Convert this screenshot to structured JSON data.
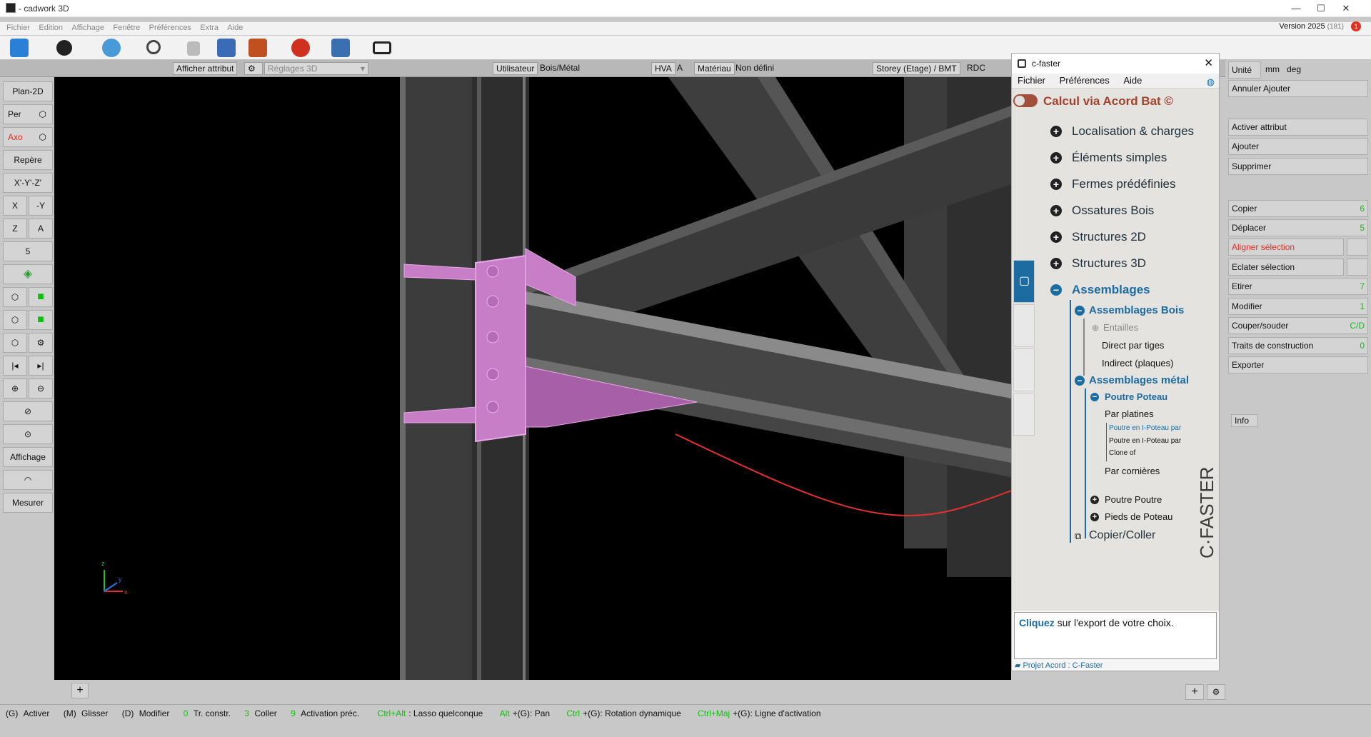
{
  "window": {
    "title": "- cadwork 3D",
    "version": "Version 2025",
    "version_build": "(181)",
    "notification_count": "1"
  },
  "menu": [
    "Fichier",
    "Edition",
    "Affichage",
    "Fenêtre",
    "Préférences",
    "Extra",
    "Aide"
  ],
  "toolbar_icons": [
    "cadwork-logo-icon",
    "record-icon",
    "cloud-c-icon",
    "search-icon",
    "lock-icon",
    "csv-export-icon",
    "dance-icon",
    "pdf-icon",
    "python-icon",
    "present-icon"
  ],
  "control_bar": {
    "attr_button": "Afficher attribut",
    "settings3d": "Réglages 3D",
    "user_label": "Utilisateur",
    "user_value": "Bois/Métal",
    "hva_label": "HVA",
    "hva_value": "A",
    "material_label": "Matériau",
    "material_value": "Non défini",
    "storey_label": "Storey (Etage) / BMT",
    "storey_value": "RDC"
  },
  "left_toolbar": {
    "plan2d": "Plan-2D",
    "per": "Per",
    "axo": "Axo",
    "repere": "Repère",
    "xyz": "X'-Y'-Z'",
    "x": "X",
    "neg_y": "-Y",
    "z": "Z",
    "a": "A",
    "five": "5",
    "affichage": "Affichage",
    "mesurer": "Mesurer"
  },
  "axes": {
    "x": "x",
    "y": "y",
    "z": "z"
  },
  "status_bar": [
    {
      "key": "(G)",
      "text": "Activer"
    },
    {
      "key": "(M)",
      "text": "Glisser"
    },
    {
      "key": "(D)",
      "text": "Modifier"
    },
    {
      "key": "0",
      "text": "Tr. constr."
    },
    {
      "key": "3",
      "text": "Coller"
    },
    {
      "key": "9",
      "text": "Activation préc."
    },
    {
      "key": "Ctrl+Alt",
      "text": ": Lasso quelconque"
    },
    {
      "key": "Alt",
      "text": "+(G): Pan"
    },
    {
      "key": "Ctrl",
      "text": "+(G): Rotation dynamique"
    },
    {
      "key": "Ctrl+Maj",
      "text": "+(G): Ligne d'activation"
    }
  ],
  "cfaster": {
    "title": "c-faster",
    "menu": [
      "Fichier",
      "Préférences",
      "Aide"
    ],
    "acord": "Calcul via Acord Bat ©",
    "categories": [
      "Localisation & charges",
      "Éléments simples",
      "Fermes prédéfinies",
      "Ossatures Bois",
      "Structures 2D",
      "Structures 3D",
      "Assemblages"
    ],
    "assemblages_bois": "Assemblages Bois",
    "entailles": "Entailles",
    "direct": "Direct par tiges",
    "indirect": "Indirect (plaques)",
    "assemblages_metal": "Assemblages métal",
    "poutre_poteau": "Poutre Poteau",
    "par_platines": "Par platines",
    "item1": "Poutre en I-Poteau par",
    "item2": "Poutre en I-Poteau par",
    "item3": "Clone of",
    "par_cornieres": "Par cornières",
    "poutre_poutre": "Poutre Poutre",
    "pieds": "Pieds de Poteau",
    "copier": "Copier/Coller",
    "brand": "C·FASTER",
    "info_click": "Cliquez",
    "info_rest": " sur l'export de votre choix.",
    "footer": "Projet Acord : C-Faster"
  },
  "right_panel": {
    "units": {
      "label": "Unité",
      "length": "mm",
      "angle": "deg"
    },
    "annuler": "Annuler Ajouter",
    "activer_attr": "Activer attribut",
    "ajouter": "Ajouter",
    "supprimer": "Supprimer",
    "actions": [
      {
        "label": "Copier",
        "key": "6"
      },
      {
        "label": "Déplacer",
        "key": "5"
      },
      {
        "label": "Aligner sélection",
        "key": ""
      },
      {
        "label": "Eclater sélection",
        "key": ""
      },
      {
        "label": "Etirer",
        "key": "7"
      },
      {
        "label": "Modifier",
        "key": "1"
      },
      {
        "label": "Couper/souder",
        "key": "C/D"
      },
      {
        "label": "Traits de construction",
        "key": "0"
      },
      {
        "label": "Exporter",
        "key": ""
      }
    ],
    "info_tab": "Info"
  }
}
